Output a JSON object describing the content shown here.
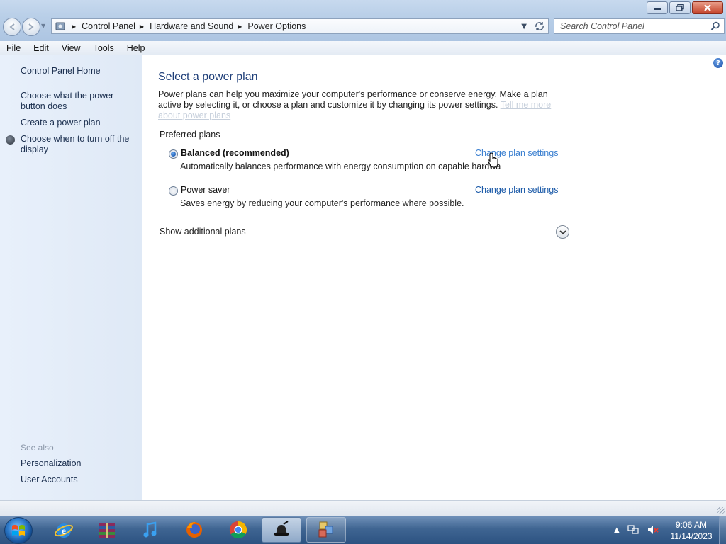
{
  "window": {
    "minimize_icon": "minimize-icon",
    "maximize_icon": "restore-icon",
    "close_icon": "close-icon"
  },
  "address_bar": {
    "breadcrumbs": [
      "Control Panel",
      "Hardware and Sound",
      "Power Options"
    ]
  },
  "search": {
    "placeholder": "Search Control Panel"
  },
  "menu": [
    "File",
    "Edit",
    "View",
    "Tools",
    "Help"
  ],
  "sidebar": {
    "home_link": "Control Panel Home",
    "links": [
      "Choose what the power button does",
      "Create a power plan",
      "Choose when to turn off the display"
    ],
    "see_also_label": "See also",
    "see_also_links": [
      "Personalization",
      "User Accounts"
    ]
  },
  "main": {
    "title": "Select a power plan",
    "intro": "Power plans can help you maximize your computer's performance or conserve energy. Make a plan active by selecting it, or choose a plan and customize it by changing its power settings.",
    "tell_me_more": "Tell me more about power plans",
    "preferred_plans_label": "Preferred plans",
    "plans": [
      {
        "name": "Balanced (recommended)",
        "description": "Automatically balances performance with energy consumption on capable hardwa",
        "link": "Change plan settings",
        "selected": true
      },
      {
        "name": "Power saver",
        "description": "Saves energy by reducing your computer's performance where possible.",
        "link": "Change plan settings",
        "selected": false
      }
    ],
    "additional_plans_label": "Show additional plans"
  },
  "taskbar": {
    "items": [
      "internet-explorer-icon",
      "winrar-icon",
      "itunes-icon",
      "firefox-icon",
      "chrome-icon",
      "bowler-hat-icon",
      "control-panel-icon"
    ],
    "clock_time": "9:06 AM",
    "clock_date": "11/14/2023"
  },
  "colors": {
    "link": "#1b5aa8",
    "title": "#1f3f79",
    "sidebar_bg": "#e8f0fb",
    "taskbar": "#3f6592"
  }
}
